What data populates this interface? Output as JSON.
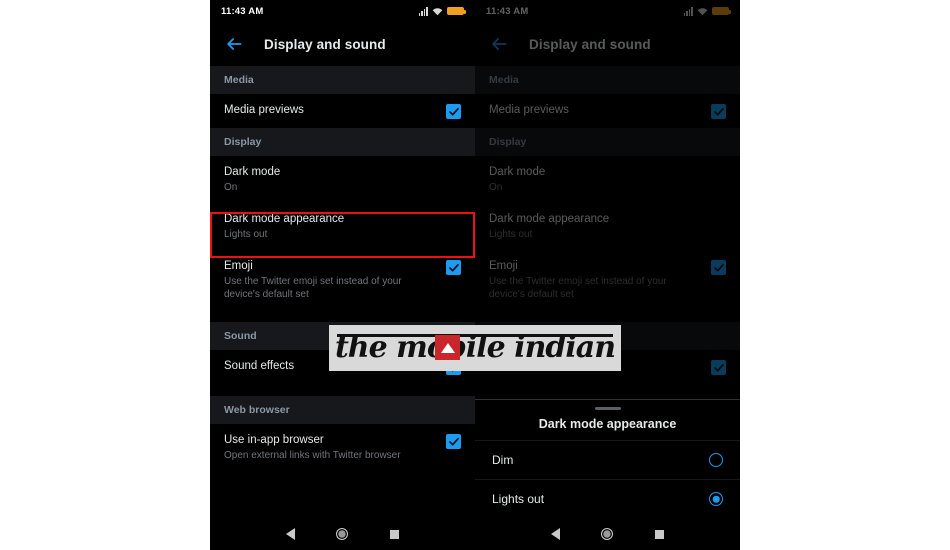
{
  "status_bar": {
    "time": "11:43 AM",
    "icons": [
      "signal-icon",
      "wifi-icon",
      "battery-icon"
    ],
    "battery_color": "#f0a020"
  },
  "app_bar": {
    "back_icon": "back-arrow-icon",
    "title": "Display and sound"
  },
  "colors": {
    "background": "#000000",
    "section_header_bg": "#16181c",
    "accent": "#1d9bf0",
    "primary_text": "#e7e9ea",
    "secondary_text": "#71767b",
    "highlight_border": "#ee1111",
    "watermark_badge": "#c8262b"
  },
  "settings": {
    "sections": [
      {
        "header": "Media",
        "rows": [
          {
            "title": "Media previews",
            "subtitle": "",
            "control": "checkbox",
            "checked": true
          }
        ]
      },
      {
        "header": "Display",
        "rows": [
          {
            "title": "Dark mode",
            "subtitle": "On",
            "control": "none",
            "checked": false
          },
          {
            "title": "Dark mode appearance",
            "subtitle": "Lights out",
            "control": "none",
            "checked": false,
            "highlighted": true
          },
          {
            "title": "Emoji",
            "subtitle": "Use the Twitter emoji set instead of your device's default set",
            "control": "checkbox",
            "checked": true
          }
        ]
      },
      {
        "header": "Sound",
        "rows": [
          {
            "title": "Sound effects",
            "subtitle": "",
            "control": "checkbox",
            "checked": true
          }
        ]
      },
      {
        "header": "Web browser",
        "rows": [
          {
            "title": "Use in-app browser",
            "subtitle": "Open external links with Twitter browser",
            "control": "checkbox",
            "checked": true
          }
        ]
      }
    ]
  },
  "bottom_sheet": {
    "title": "Dark mode appearance",
    "options": [
      {
        "label": "Dim",
        "selected": false
      },
      {
        "label": "Lights out",
        "selected": true,
        "highlighted": true
      }
    ]
  },
  "nav_bar": {
    "items": [
      "back-triangle-icon",
      "home-circle-icon",
      "recents-square-icon"
    ]
  },
  "watermark": {
    "text": "the mobile indian",
    "badge_icon": "triangle-play-icon"
  }
}
